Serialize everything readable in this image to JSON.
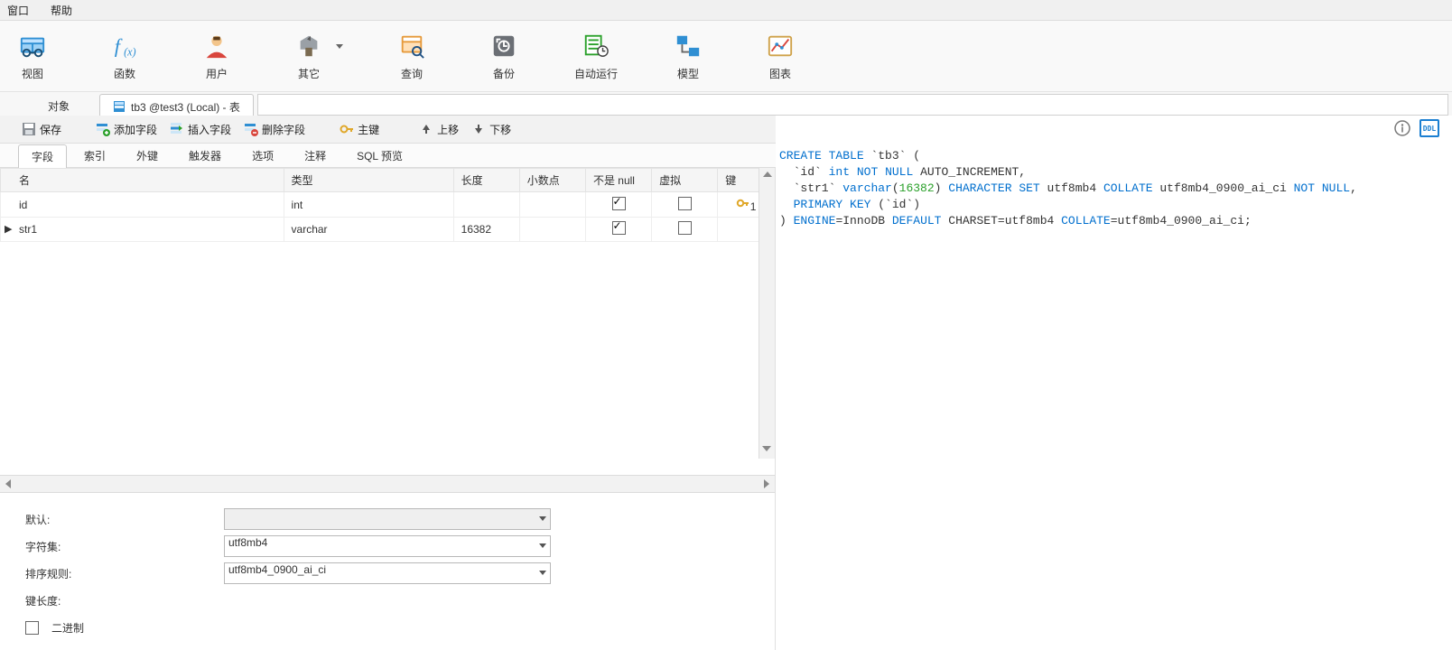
{
  "topmenu": {
    "window": "窗口",
    "help": "帮助"
  },
  "ribbon": {
    "view": "视图",
    "func": "函数",
    "user": "用户",
    "other": "其它",
    "query": "查询",
    "backup": "备份",
    "auto": "自动运行",
    "model": "模型",
    "chart": "图表"
  },
  "tabs": {
    "objects": "对象",
    "design": "tb3 @test3 (Local) - 表"
  },
  "subtool": {
    "save": "保存",
    "addf": "添加字段",
    "insf": "插入字段",
    "delf": "删除字段",
    "pkey": "主键",
    "up": "上移",
    "down": "下移"
  },
  "dtabs": {
    "fields": "字段",
    "indexes": "索引",
    "fks": "外键",
    "triggers": "触发器",
    "options": "选项",
    "comments": "注释",
    "sqlprev": "SQL 预览"
  },
  "grid": {
    "hdr": {
      "name": "名",
      "type": "类型",
      "len": "长度",
      "dec": "小数点",
      "nn": "不是 null",
      "virt": "虚拟",
      "key": "键"
    },
    "rows": [
      {
        "name": "id",
        "type": "int",
        "len": "",
        "dec": "",
        "nn": true,
        "virt": false,
        "pk": "1"
      },
      {
        "name": "str1",
        "type": "varchar",
        "len": "16382",
        "dec": "",
        "nn": true,
        "virt": false,
        "pk": ""
      }
    ]
  },
  "props": {
    "default_l": "默认:",
    "charset_l": "字符集:",
    "collate_l": "排序规则:",
    "keylen_l": "键长度:",
    "binary_l": "二进制",
    "charset_v": "utf8mb4",
    "collate_v": "utf8mb4_0900_ai_ci"
  },
  "sql": {
    "line1a": "CREATE",
    "line1b": "TABLE",
    "line1c": "`tb3`",
    "line1d": "(",
    "line2a": "  `id`",
    "line2b": "int",
    "line2c": "NOT",
    "line2d": "NULL",
    "line2e": "AUTO_INCREMENT,",
    "line3a": "  `str1`",
    "line3b": "varchar",
    "line3c": "16382",
    "line3d": "CHARACTER",
    "line3e": "SET",
    "line3f": "utf8mb4",
    "line3g": "COLLATE",
    "line3h": "utf8mb4_0900_ai_ci",
    "line3i": "NOT",
    "line3j": "NULL",
    "line3k": ",",
    "line4a": "  PRIMARY",
    "line4b": "KEY",
    "line4c": "(`id`)",
    "line5a": ")",
    "line5b": "ENGINE",
    "line5c": "=InnoDB",
    "line5d": "DEFAULT",
    "line5e": "CHARSET=utf8mb4",
    "line5f": "COLLATE",
    "line5g": "=utf8mb4_0900_ai_ci;"
  }
}
